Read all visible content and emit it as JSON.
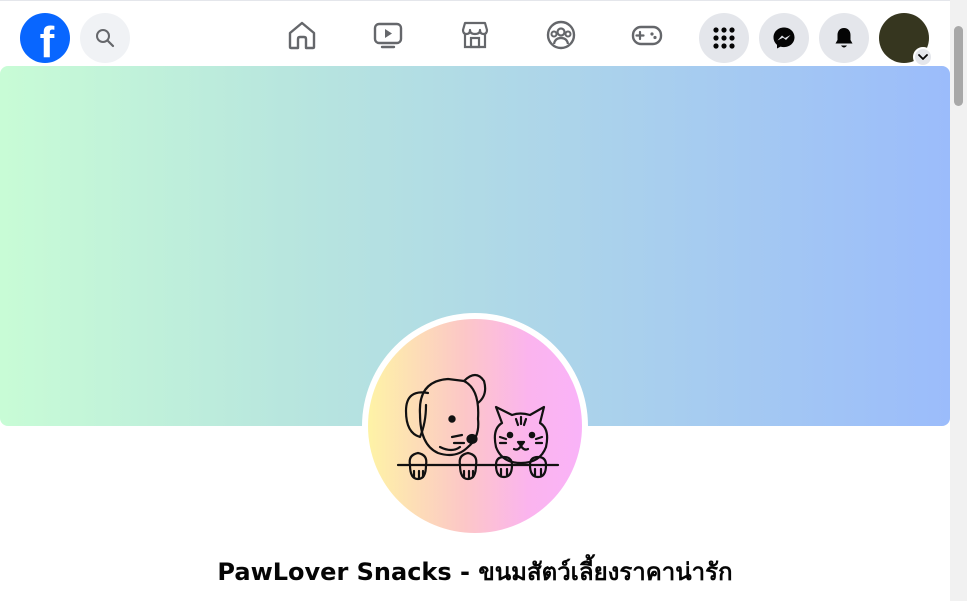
{
  "app": {
    "brand_icon": "facebook-logo",
    "brand_color": "#0866ff"
  },
  "topbar": {
    "search_icon": "search-icon",
    "nav": [
      {
        "name": "home",
        "icon": "home-icon"
      },
      {
        "name": "watch",
        "icon": "video-icon"
      },
      {
        "name": "marketplace",
        "icon": "store-icon"
      },
      {
        "name": "groups",
        "icon": "groups-icon"
      },
      {
        "name": "gaming",
        "icon": "gamepad-icon"
      }
    ],
    "actions": [
      {
        "name": "menu",
        "icon": "grid-menu-icon"
      },
      {
        "name": "messenger",
        "icon": "messenger-icon"
      },
      {
        "name": "notifications",
        "icon": "bell-icon"
      }
    ],
    "account_icon": "avatar"
  },
  "profile": {
    "name": "PawLover Snacks - ขนมสัตว์เลี้ยงราคาน่ารัก",
    "cover_colors": [
      "#c8fcd6",
      "#9bbcfb"
    ],
    "picture_icon": "dog-and-cat-illustration"
  }
}
